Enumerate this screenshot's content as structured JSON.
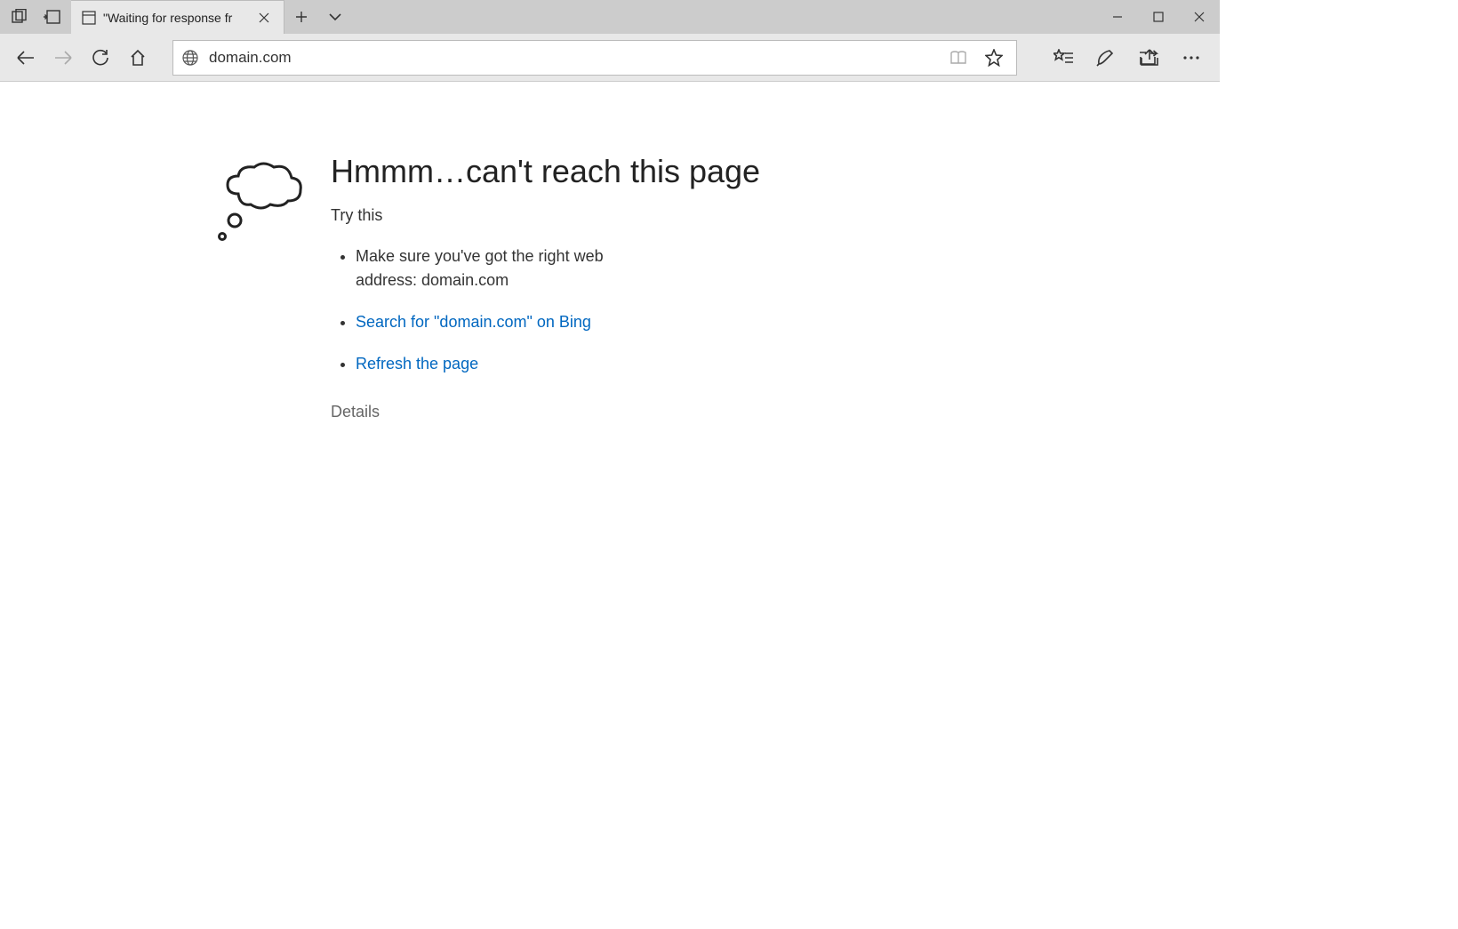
{
  "tab": {
    "title": "\"Waiting for response fr"
  },
  "addressbar": {
    "value": "domain.com"
  },
  "error": {
    "title": "Hmmm…can't reach this page",
    "subtitle": "Try this",
    "items": {
      "check_address": "Make sure you've got the right web address: domain.com",
      "search_bing": "Search for \"domain.com\" on Bing",
      "refresh": "Refresh the page"
    },
    "details_label": "Details"
  }
}
